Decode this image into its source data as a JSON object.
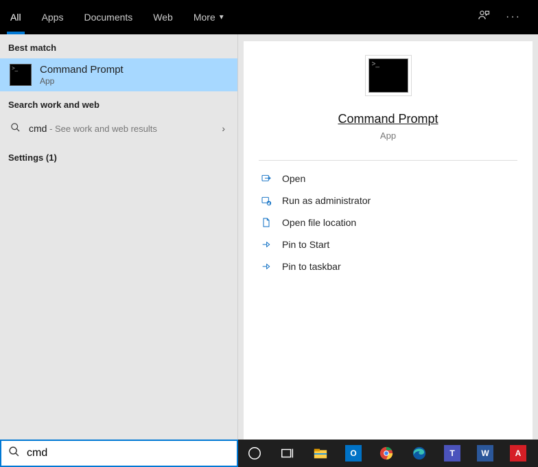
{
  "tabs": {
    "all": "All",
    "apps": "Apps",
    "documents": "Documents",
    "web": "Web",
    "more": "More"
  },
  "left": {
    "best_match_label": "Best match",
    "result_title": "Command Prompt",
    "result_sub": "App",
    "search_web_label": "Search work and web",
    "web_query": "cmd",
    "web_tail": " - See work and web results",
    "settings_label": "Settings (1)"
  },
  "preview": {
    "title": "Command Prompt",
    "sub": "App",
    "actions": {
      "open": "Open",
      "runadmin": "Run as administrator",
      "openloc": "Open file location",
      "pinstart": "Pin to Start",
      "pintaskbar": "Pin to taskbar"
    }
  },
  "search": {
    "value": "cmd"
  }
}
